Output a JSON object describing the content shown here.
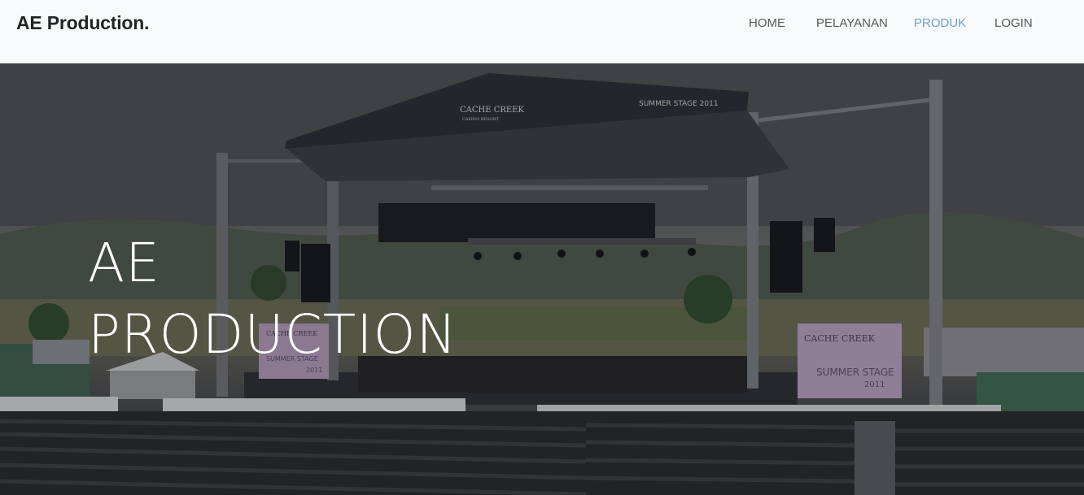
{
  "navbar": {
    "brand": "AE Production.",
    "links": [
      {
        "label": "HOME",
        "active": false
      },
      {
        "label": "PELAYANAN",
        "active": false
      },
      {
        "label": "PRODUK",
        "active": true
      },
      {
        "label": "LOGIN",
        "active": false
      }
    ]
  },
  "hero": {
    "title_line1": "AE",
    "title_line2": "PRODUCTION",
    "background_image": "outdoor concert stage with truss roof, speakers, screens and rows of seats",
    "roof_sign_left": "CACHE CREEK",
    "roof_sign_left_sub": "CASINO RESORT",
    "roof_sign_right": "SUMMER STAGE 2011",
    "screen_text_top": "CACHE CREEK",
    "screen_text_bottom": "SUMMER STAGE",
    "screen_year": "2011"
  },
  "colors": {
    "navbar_bg": "#f8f9fa",
    "brand": "#212529",
    "nav_link": "#555a60",
    "nav_link_active": "#6ca1c4",
    "hero_title": "#ffffff"
  }
}
